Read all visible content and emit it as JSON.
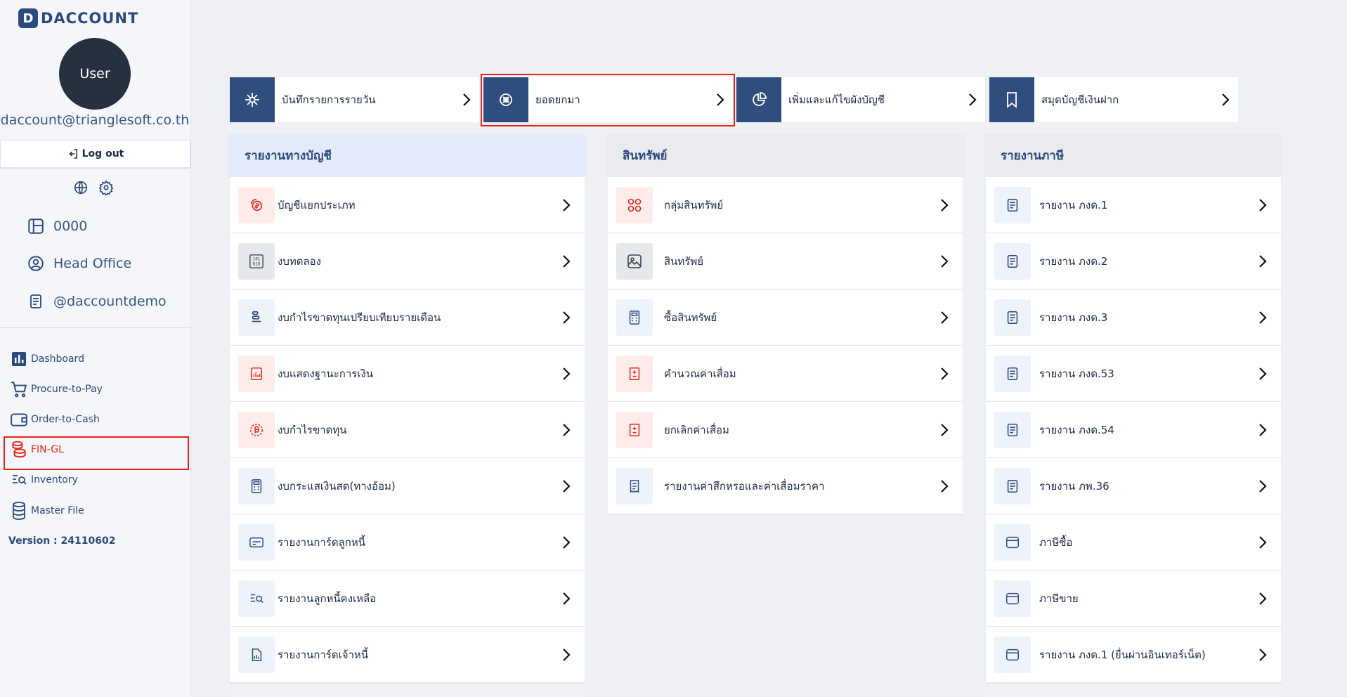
{
  "app": {
    "logo_letter": "D",
    "logo_text": "DACCOUNT"
  },
  "user": {
    "avatar_label": "User",
    "email": "daccount@trianglesoft.co.th",
    "logout_label": "Log out"
  },
  "company": {
    "code": "0000",
    "branch": "Head Office",
    "account": "@daccountdemo"
  },
  "nav": {
    "items": [
      {
        "label": "Dashboard",
        "icon": "bar-chart-icon"
      },
      {
        "label": "Procure-to-Pay",
        "icon": "cart-icon"
      },
      {
        "label": "Order-to-Cash",
        "icon": "wallet-icon"
      },
      {
        "label": "FIN-GL",
        "icon": "coins-stack-icon",
        "active": true
      },
      {
        "label": "Inventory",
        "icon": "list-search-icon"
      },
      {
        "label": "Master File",
        "icon": "database-icon"
      }
    ],
    "version": "Version : 24110602"
  },
  "quick": [
    {
      "label": "บันทึกรายการรายวัน",
      "icon": "snowflake-icon"
    },
    {
      "label": "ยอดยกมา",
      "icon": "globe-refresh-icon",
      "highlighted": true
    },
    {
      "label": "เพิ่มและแก้ไขผังบัญชี",
      "icon": "pie-chart-icon"
    },
    {
      "label": "สมุดบัญชีเงินฝาก",
      "icon": "bookmark-icon"
    }
  ],
  "panels": {
    "accounting": {
      "title": "รายงานทางบัญชี",
      "items": [
        {
          "label": "บัญชีแยกประเภท",
          "icon": "coin-loop-icon",
          "tone": "red"
        },
        {
          "label": "งบทดลอง",
          "icon": "binary-icon",
          "tone": "grey"
        },
        {
          "label": "งบกำไรขาดทุนเปรียบเทียบรายเดือน",
          "icon": "stack-icon",
          "tone": "blue"
        },
        {
          "label": "งบแสดงฐานะการเงิน",
          "icon": "report-chart-icon",
          "tone": "red"
        },
        {
          "label": "งบกำไรขาดทุน",
          "icon": "bitcoin-icon",
          "tone": "red"
        },
        {
          "label": "งบกระแสเงินสด(ทางอ้อม)",
          "icon": "calculator-icon",
          "tone": "blue"
        },
        {
          "label": "รายงานการ์ดลูกหนี้",
          "icon": "card-icon",
          "tone": "blue"
        },
        {
          "label": "รายงานลูกหนี้คงเหลือ",
          "icon": "list-search-icon",
          "tone": "blue"
        },
        {
          "label": "รายงานการ์ดเจ้าหนี้",
          "icon": "document-chart-icon",
          "tone": "blue"
        }
      ]
    },
    "assets": {
      "title": "สินทรัพย์",
      "items": [
        {
          "label": "กลุ่มสินทรัพย์",
          "icon": "grid-circles-icon",
          "tone": "red"
        },
        {
          "label": "สินทรัพย์",
          "icon": "image-icon",
          "tone": "grey"
        },
        {
          "label": "ซื้อสินทรัพย์",
          "icon": "calculator-icon",
          "tone": "blue"
        },
        {
          "label": "คำนวณค่าเสื่อม",
          "icon": "doc-plus-minus-icon",
          "tone": "red"
        },
        {
          "label": "ยกเลิกค่าเสื่อม",
          "icon": "doc-plus-minus-icon",
          "tone": "red"
        },
        {
          "label": "รายงานค่าสึกหรอและค่าเสื่อมราคา",
          "icon": "receipt-icon",
          "tone": "blue"
        }
      ]
    },
    "tax": {
      "title": "รายงานภาษี",
      "items": [
        {
          "label": "รายงาน ภงด.1",
          "icon": "document-icon"
        },
        {
          "label": "รายงาน ภงด.2",
          "icon": "document-icon"
        },
        {
          "label": "รายงาน ภงด.3",
          "icon": "document-icon"
        },
        {
          "label": "รายงาน ภงด.53",
          "icon": "document-icon"
        },
        {
          "label": "รายงาน ภงด.54",
          "icon": "document-icon"
        },
        {
          "label": "รายงาน ภพ.36",
          "icon": "document-icon"
        },
        {
          "label": "ภาษีซื้อ",
          "icon": "browser-icon"
        },
        {
          "label": "ภาษีขาย",
          "icon": "browser-icon"
        },
        {
          "label": "รายงาน ภงด.1 (ยื่นผ่านอินเทอร์เน็ต)",
          "icon": "browser-icon"
        }
      ]
    }
  },
  "colors": {
    "brand": "#2b4a7c",
    "accent_red": "#e1251b",
    "background": "#eef0f4"
  }
}
